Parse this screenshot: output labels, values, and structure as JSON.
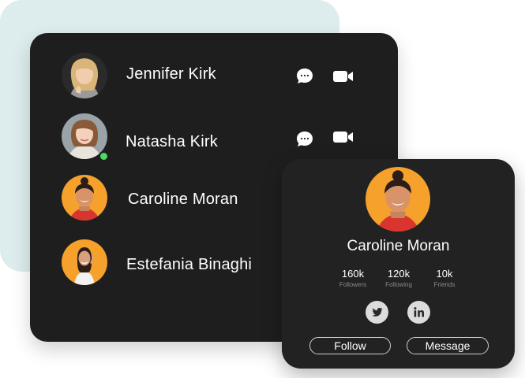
{
  "contacts": [
    {
      "name": "Jennifer Kirk",
      "avatar_bg": "#2a2a2a",
      "online": false,
      "has_actions": true
    },
    {
      "name": "Natasha Kirk",
      "avatar_bg": "#9aa3a8",
      "online": true,
      "has_actions": true
    },
    {
      "name": "Caroline Moran",
      "avatar_bg": "#f5a12b",
      "online": false,
      "has_actions": false
    },
    {
      "name": "Estefania Binaghi",
      "avatar_bg": "#f5a12b",
      "online": false,
      "has_actions": false
    }
  ],
  "icons": {
    "chat": "chat-bubble-icon",
    "video": "video-camera-icon",
    "twitter": "twitter-icon",
    "linkedin": "linkedin-icon"
  },
  "profile": {
    "name": "Caroline Moran",
    "avatar_bg": "#f5a12b",
    "stats": [
      {
        "value": "160k",
        "label": "Followers"
      },
      {
        "value": "120k",
        "label": "Following"
      },
      {
        "value": "10k",
        "label": "Friends"
      }
    ],
    "follow_label": "Follow",
    "message_label": "Message"
  },
  "colors": {
    "panel_bg": "#1e1e1e",
    "card_bg": "#222222",
    "backdrop": "#ddecec",
    "online": "#4cd964",
    "avatar_orange": "#f5a12b"
  }
}
